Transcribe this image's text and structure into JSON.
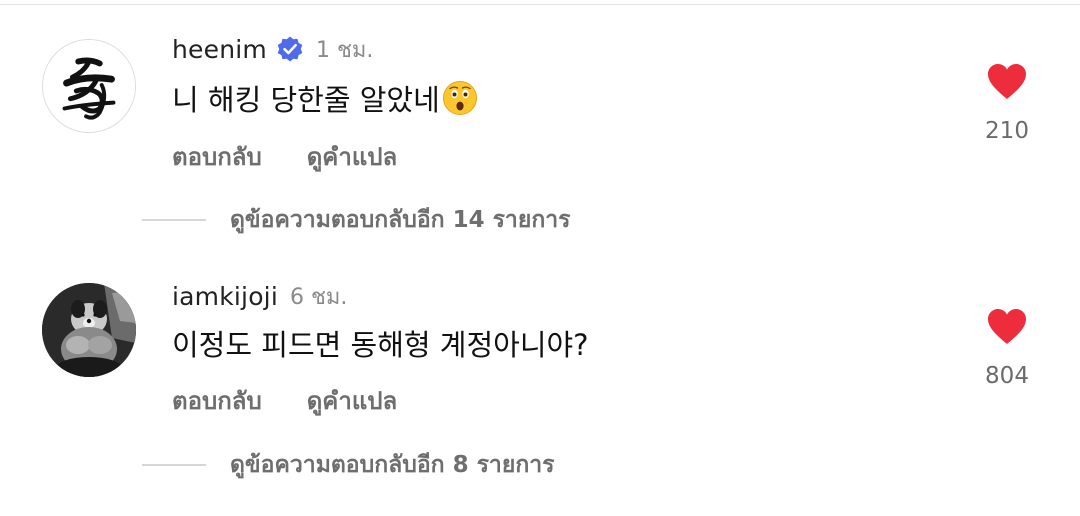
{
  "comments": [
    {
      "username": "heenim",
      "verified": true,
      "time": "1 ชม.",
      "text": "니 해킹 당한줄 알았네",
      "emoji": "astonished-face",
      "reply_label": "ตอบกลับ",
      "translate_label": "ดูคำแปล",
      "like_count": "210",
      "view_replies_label": "ดูข้อความตอบกลับอีก 14 รายการ"
    },
    {
      "username": "iamkijoji",
      "verified": false,
      "time": "6 ชม.",
      "text": "이정도 피드면 동해형 계정아니야?",
      "reply_label": "ตอบกลับ",
      "translate_label": "ดูคำแปล",
      "like_count": "804",
      "view_replies_label": "ดูข้อความตอบกลับอีก 8 รายการ"
    }
  ],
  "colors": {
    "heart": "#ee2d3c",
    "verified": "#4f6bea",
    "secondary_text": "#6e6e6e"
  }
}
